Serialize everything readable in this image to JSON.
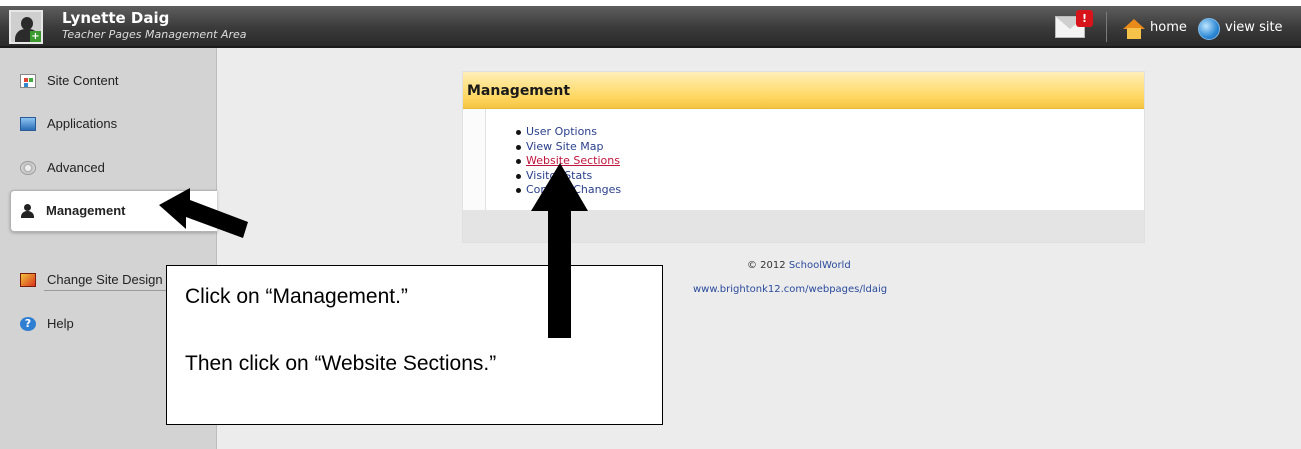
{
  "header": {
    "user_name": "Lynette Daig",
    "subtitle": "Teacher Pages Management Area",
    "mail_badge": "!",
    "home_label": "home",
    "view_site_label": "view site"
  },
  "sidebar": {
    "items": [
      {
        "label": "Site Content",
        "icon": "site-content-icon"
      },
      {
        "label": "Applications",
        "icon": "applications-icon"
      },
      {
        "label": "Advanced",
        "icon": "advanced-icon"
      },
      {
        "label": "Management",
        "icon": "management-icon",
        "active": true
      },
      {
        "label": "Change Site Design",
        "icon": "change-site-design-icon"
      },
      {
        "label": "Help",
        "icon": "help-icon"
      }
    ]
  },
  "panel": {
    "title": "Management",
    "links": [
      "User Options",
      "View Site Map",
      "Website Sections",
      "Visitor Stats",
      "Content Changes"
    ]
  },
  "footer": {
    "copyright": "© 2012",
    "company": "SchoolWorld",
    "site_url": "www.brightonk12.com/webpages/ldaig"
  },
  "annotation": {
    "line1": "Click on “Management.”",
    "line2": "Then click on “Website Sections.”"
  }
}
